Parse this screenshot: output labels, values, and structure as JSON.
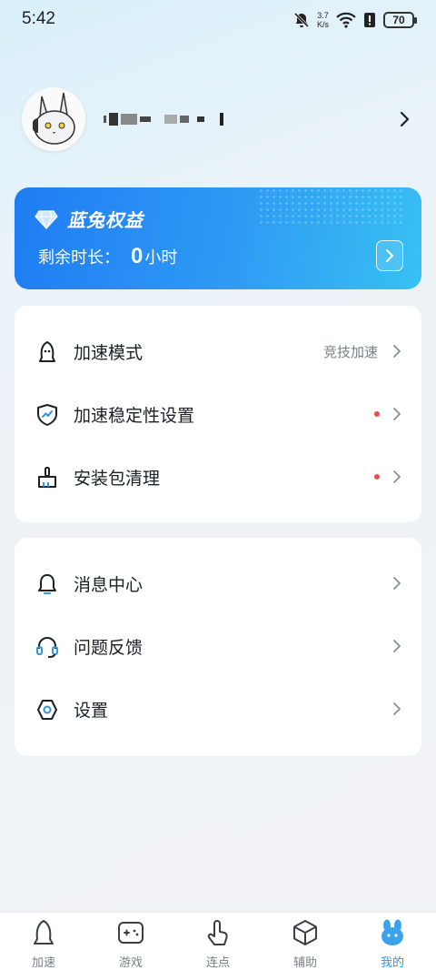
{
  "status_bar": {
    "time": "5:42",
    "net_speed_value": "3.7",
    "net_speed_unit": "K/s",
    "battery": "70"
  },
  "profile": {
    "avatar_icon": "rabbit-avatar",
    "chevron_icon": "chevron-right-icon"
  },
  "vip_card": {
    "title": "蓝兔权益",
    "remaining_label": "剩余时长：",
    "remaining_value": "0",
    "remaining_unit": "小时",
    "accent_color": "#1f7cf3"
  },
  "menu_group_1": {
    "items": [
      {
        "label": "加速模式",
        "value": "竞技加速",
        "icon": "rocket-icon"
      },
      {
        "label": "加速稳定性设置",
        "value": "",
        "icon": "shield-icon",
        "dot": true
      },
      {
        "label": "安装包清理",
        "value": "",
        "icon": "brush-icon",
        "dot": true
      }
    ]
  },
  "menu_group_2": {
    "items": [
      {
        "label": "消息中心",
        "icon": "bell-icon"
      },
      {
        "label": "问题反馈",
        "icon": "headset-icon"
      },
      {
        "label": "设置",
        "icon": "gear-icon"
      }
    ]
  },
  "bottom_nav": {
    "items": [
      {
        "label": "加速",
        "icon": "rocket-icon"
      },
      {
        "label": "游戏",
        "icon": "gamepad-icon"
      },
      {
        "label": "连点",
        "icon": "tap-hand-icon"
      },
      {
        "label": "辅助",
        "icon": "cube-icon"
      },
      {
        "label": "我的",
        "icon": "bunny-icon",
        "active": true
      }
    ],
    "active_color": "#2f95e8"
  }
}
